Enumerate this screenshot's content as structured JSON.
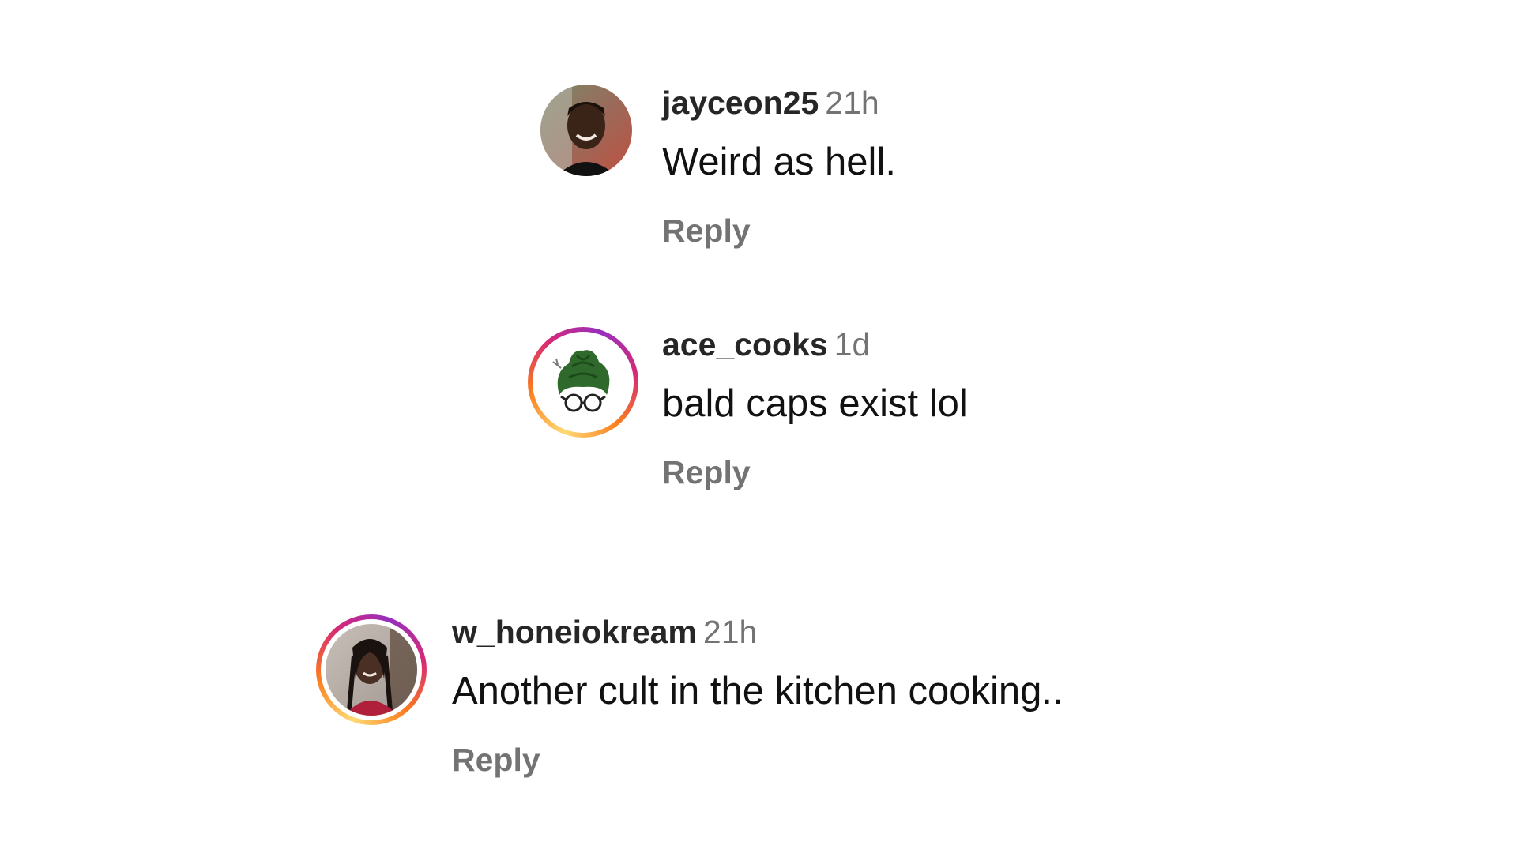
{
  "comments": [
    {
      "username": "jayceon25",
      "time": "21h",
      "text": "Weird as hell.",
      "reply_label": "Reply",
      "has_story_ring": false
    },
    {
      "username": "ace_cooks",
      "time": "1d",
      "text": "bald caps exist lol",
      "reply_label": "Reply",
      "has_story_ring": true
    },
    {
      "username": "w_honeiokream",
      "time": "21h",
      "text": "Another cult in the kitchen cooking..",
      "reply_label": "Reply",
      "has_story_ring": true
    }
  ],
  "colors": {
    "username": "#262626",
    "secondary": "#737373",
    "text": "#111111",
    "ring_start": "#feda75",
    "ring_mid": "#d62976",
    "ring_end": "#962fbf"
  }
}
